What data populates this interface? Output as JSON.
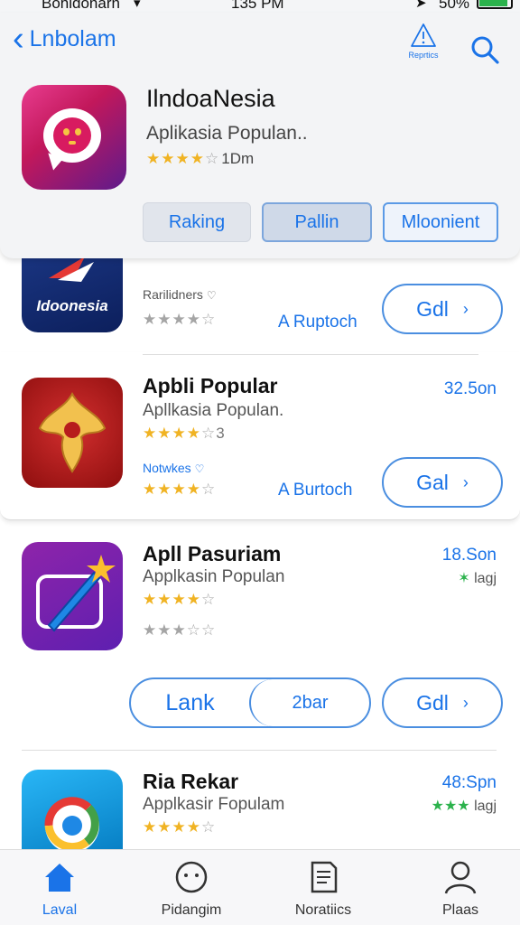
{
  "status_bar": {
    "carrier": "Bohidonarn",
    "time": "135 PM",
    "battery": "50%",
    "battery_level": 0.85
  },
  "nav": {
    "back_label": "Lnbolam",
    "reports_label": "Reprtics"
  },
  "header": {
    "title": "IlndoaNesia",
    "subtitle": "Aplikasia Populan..",
    "rating_stars": 3.5,
    "rating_count": "1Dm"
  },
  "segments": [
    "Raking",
    "Pallin",
    "Mloonient"
  ],
  "apps": [
    {
      "icon_text": "Idoonesia",
      "label1": "Rarilidners",
      "label1_icon": "heart-icon",
      "stars": 4,
      "developer": "A Ruptoch",
      "get_label": "Gdl"
    },
    {
      "title": "Apbli Popular",
      "subtitle": "Apllkasia Populan.",
      "meta": "32.5on",
      "stars_row1": 4,
      "stars_row1_suffix": "3",
      "label1": "Notwkes",
      "label1_icon": "heart-icon",
      "stars_row2": 4,
      "developer": "A Burtoch",
      "get_label": "Gal"
    },
    {
      "title": "Apll Pasuriam",
      "subtitle": "Applkasin Populan",
      "meta": "18.Son",
      "meta2": "lagj",
      "stars_row1": 4,
      "stars_row2": 3,
      "pill_left": "Lank",
      "pill_right": "2bar",
      "get_label": "Gdl"
    },
    {
      "title": "Ria Rekar",
      "subtitle": "Applkasir Fopulam",
      "meta": "48:Spn",
      "meta2": "lagj",
      "stars_row1": 4
    }
  ],
  "tabs": [
    {
      "label": "Laval",
      "icon": "home-icon",
      "active": true
    },
    {
      "label": "Pidangim",
      "icon": "smiley-icon",
      "active": false
    },
    {
      "label": "Noratiics",
      "icon": "document-icon",
      "active": false
    },
    {
      "label": "Plaas",
      "icon": "person-icon",
      "active": false
    }
  ],
  "colors": {
    "accent": "#1a73e8",
    "star": "#f0b323",
    "battery": "#2bb24c"
  }
}
